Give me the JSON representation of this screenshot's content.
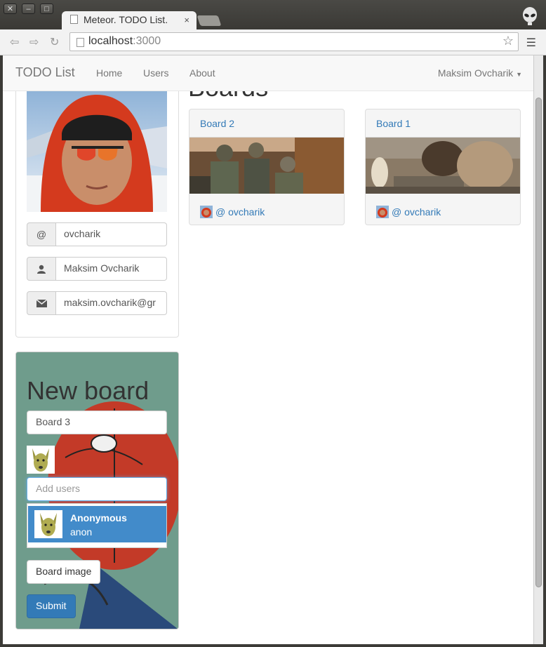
{
  "browser": {
    "tab_title": "Meteor. TODO List.",
    "tab_close": "×",
    "url_host": "localhost",
    "url_port": ":3000"
  },
  "navbar": {
    "brand": "TODO List",
    "links": [
      "Home",
      "Users",
      "About"
    ],
    "user": "Maksim Ovcharik"
  },
  "profile": {
    "username_addon": "@",
    "username": "ovcharik",
    "fullname": "Maksim Ovcharik",
    "email": "maksim.ovcharik@gr"
  },
  "boards": {
    "title": "Boards",
    "items": [
      {
        "name": "Board 2",
        "owner": "@ ovcharik"
      },
      {
        "name": "Board 1",
        "owner": "@ ovcharik"
      }
    ]
  },
  "new_board": {
    "title": "New board",
    "name_value": "Board 3",
    "add_users_placeholder": "Add users",
    "suggestion": {
      "name": "Anonymous",
      "username": "anon"
    },
    "image_button": "Board image",
    "submit_button": "Submit"
  },
  "colors": {
    "link": "#337ab7",
    "primary": "#337ab7",
    "suggestion_highlight": "#428bca"
  }
}
